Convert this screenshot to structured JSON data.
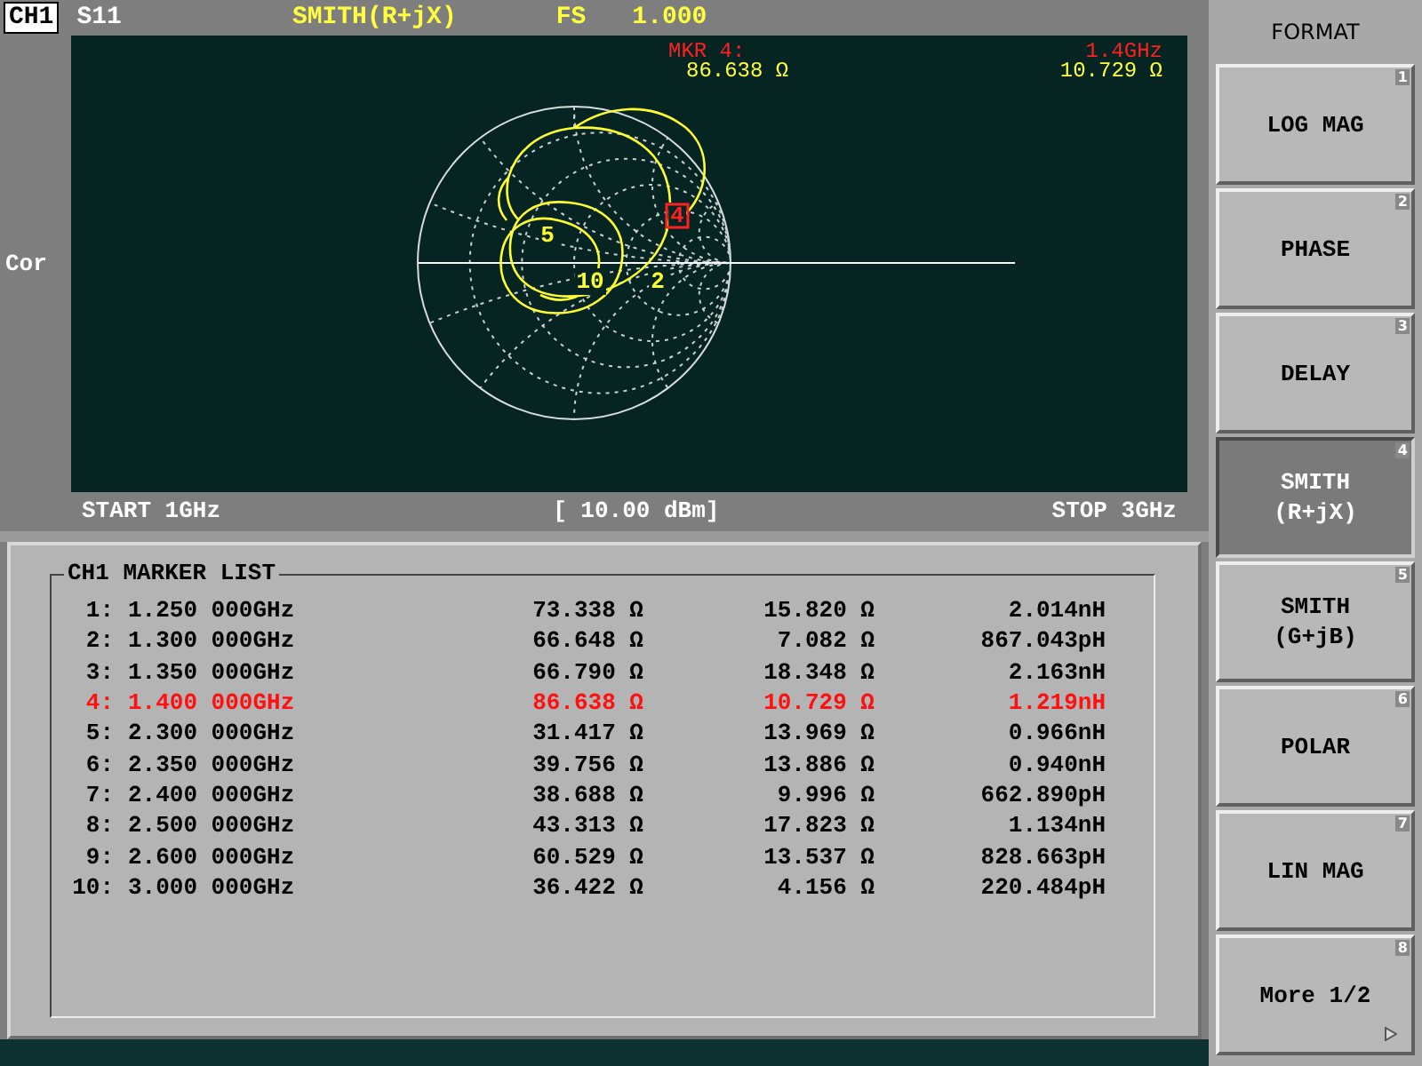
{
  "header": {
    "channel": "CH1",
    "parameter": "S11",
    "format": "SMITH(R+jX)",
    "scale_label": "FS",
    "scale_value": "1.000"
  },
  "side_label": "Cor",
  "marker_readout": {
    "label": "MKR  4:",
    "frequency": "1.4GHz",
    "resistance": "86.638 Ω",
    "reactance": "10.729 Ω"
  },
  "chart_markers": [
    {
      "label": "5",
      "selected": false
    },
    {
      "label": "10",
      "selected": false
    },
    {
      "label": "2",
      "selected": false
    },
    {
      "label": "4",
      "selected": true
    }
  ],
  "footer": {
    "start": "START 1GHz",
    "power": "[ 10.00 dBm]",
    "stop": "STOP 3GHz"
  },
  "marker_list": {
    "title": "CH1 MARKER LIST",
    "rows": [
      {
        "index": "1:",
        "frequency": "1.250 000GHz",
        "resistance": "73.338 Ω",
        "reactance": "15.820 Ω",
        "equivalent": "2.014nH",
        "selected": false
      },
      {
        "index": "2:",
        "frequency": "1.300 000GHz",
        "resistance": "66.648 Ω",
        "reactance": "7.082 Ω",
        "equivalent": "867.043pH",
        "selected": false
      },
      {
        "index": "3:",
        "frequency": "1.350 000GHz",
        "resistance": "66.790 Ω",
        "reactance": "18.348 Ω",
        "equivalent": "2.163nH",
        "selected": false
      },
      {
        "index": "4:",
        "frequency": "1.400 000GHz",
        "resistance": "86.638 Ω",
        "reactance": "10.729 Ω",
        "equivalent": "1.219nH",
        "selected": true
      },
      {
        "index": "5:",
        "frequency": "2.300 000GHz",
        "resistance": "31.417 Ω",
        "reactance": "13.969 Ω",
        "equivalent": "0.966nH",
        "selected": false
      },
      {
        "index": "6:",
        "frequency": "2.350 000GHz",
        "resistance": "39.756 Ω",
        "reactance": "13.886 Ω",
        "equivalent": "0.940nH",
        "selected": false
      },
      {
        "index": "7:",
        "frequency": "2.400 000GHz",
        "resistance": "38.688 Ω",
        "reactance": "9.996 Ω",
        "equivalent": "662.890pH",
        "selected": false
      },
      {
        "index": "8:",
        "frequency": "2.500 000GHz",
        "resistance": "43.313 Ω",
        "reactance": "17.823 Ω",
        "equivalent": "1.134nH",
        "selected": false
      },
      {
        "index": "9:",
        "frequency": "2.600 000GHz",
        "resistance": "60.529 Ω",
        "reactance": "13.537 Ω",
        "equivalent": "828.663pH",
        "selected": false
      },
      {
        "index": "10:",
        "frequency": "3.000 000GHz",
        "resistance": "36.422 Ω",
        "reactance": "4.156 Ω",
        "equivalent": "220.484pH",
        "selected": false
      }
    ]
  },
  "softkeys": {
    "title": "FORMAT",
    "keys": [
      {
        "kind": "format",
        "lines": [
          "LOG MAG"
        ],
        "number": "1",
        "selected": false
      },
      {
        "kind": "format",
        "lines": [
          "PHASE"
        ],
        "number": "2",
        "selected": false
      },
      {
        "kind": "format",
        "lines": [
          "DELAY"
        ],
        "number": "3",
        "selected": false
      },
      {
        "kind": "format",
        "lines": [
          "SMITH",
          "(R+jX)"
        ],
        "number": "4",
        "selected": true
      },
      {
        "kind": "format",
        "lines": [
          "SMITH",
          "(G+jB)"
        ],
        "number": "5",
        "selected": false
      },
      {
        "kind": "format",
        "lines": [
          "POLAR"
        ],
        "number": "6",
        "selected": false
      },
      {
        "kind": "format",
        "lines": [
          "LIN MAG"
        ],
        "number": "7",
        "selected": false
      },
      {
        "kind": "submenu",
        "lines": [
          "More 1/2"
        ],
        "number": "8",
        "selected": false
      }
    ]
  }
}
